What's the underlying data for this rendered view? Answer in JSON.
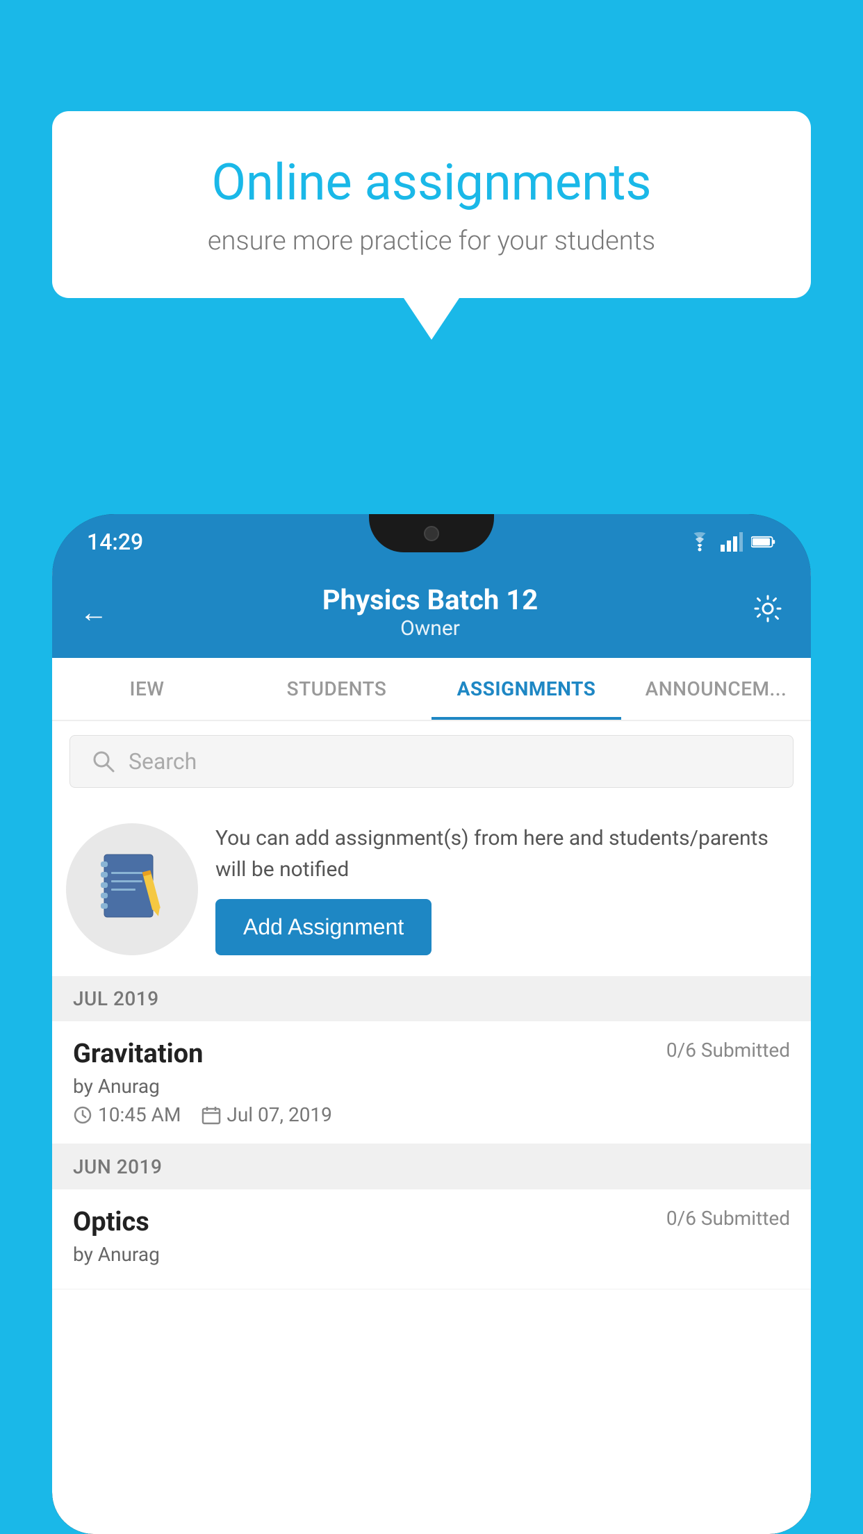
{
  "background": {
    "color": "#1ab8e8"
  },
  "speech_bubble": {
    "title": "Online assignments",
    "subtitle": "ensure more practice for your students"
  },
  "phone": {
    "status_bar": {
      "time": "14:29",
      "icons": [
        "wifi",
        "signal",
        "battery"
      ]
    },
    "header": {
      "title": "Physics Batch 12",
      "subtitle": "Owner",
      "back_label": "←",
      "settings_label": "⚙"
    },
    "tabs": [
      {
        "label": "IEW",
        "active": false
      },
      {
        "label": "STUDENTS",
        "active": false
      },
      {
        "label": "ASSIGNMENTS",
        "active": true
      },
      {
        "label": "ANNOUNCEM...",
        "active": false
      }
    ],
    "search": {
      "placeholder": "Search"
    },
    "promo": {
      "description": "You can add assignment(s) from here and students/parents will be notified",
      "add_button_label": "Add Assignment"
    },
    "sections": [
      {
        "header": "JUL 2019",
        "assignments": [
          {
            "name": "Gravitation",
            "submitted": "0/6 Submitted",
            "author": "by Anurag",
            "time": "10:45 AM",
            "date": "Jul 07, 2019"
          }
        ]
      },
      {
        "header": "JUN 2019",
        "assignments": [
          {
            "name": "Optics",
            "submitted": "0/6 Submitted",
            "author": "by Anurag",
            "time": "",
            "date": ""
          }
        ]
      }
    ]
  }
}
